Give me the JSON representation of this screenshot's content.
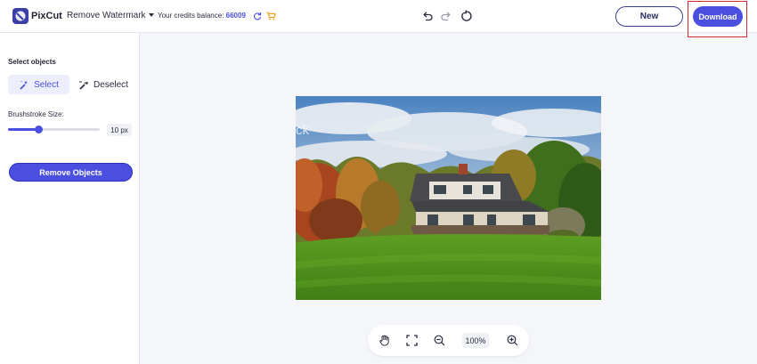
{
  "header": {
    "brand": "PixCut",
    "tool_selector": "Remove Watermark",
    "credits_label": "Your credits balance:",
    "credits_value": "66009",
    "new_label": "New",
    "download_label": "Download",
    "icons": [
      "refresh-icon",
      "cart-icon",
      "undo-icon",
      "redo-icon",
      "reset-icon"
    ],
    "accent_color": "#4b4fe0"
  },
  "sidebar": {
    "section_title": "Select objects",
    "select_label": "Select",
    "deselect_label": "Deselect",
    "brush_label": "Brushstroke Size:",
    "brush_value_text": "10 px",
    "brush_slider_fraction": 0.33,
    "remove_label": "Remove Objects"
  },
  "canvas": {
    "watermark_text": "ck"
  },
  "zoom": {
    "value": "100%",
    "icons": [
      "hand-icon",
      "fit-screen-icon",
      "zoom-out-icon",
      "zoom-in-icon"
    ]
  },
  "highlight_color": "#d42a2a"
}
